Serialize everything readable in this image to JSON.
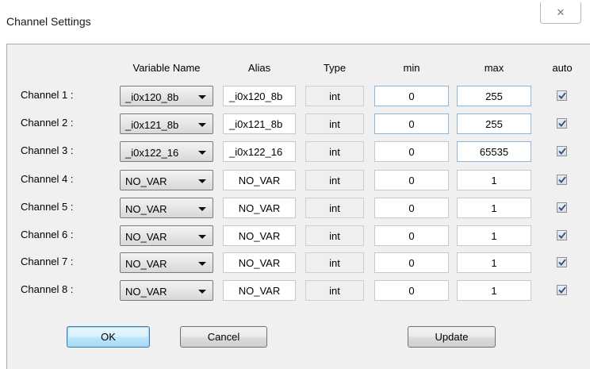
{
  "window": {
    "title": "Channel Settings",
    "close_glyph": "✕"
  },
  "headers": {
    "variable_name": "Variable Name",
    "alias": "Alias",
    "type": "Type",
    "min": "min",
    "max": "max",
    "auto": "auto"
  },
  "channels": [
    {
      "label": "Channel 1 :",
      "variable": "_i0x120_8b",
      "alias": "_i0x120_8b",
      "type": "int",
      "min": "0",
      "max": "255",
      "auto": true
    },
    {
      "label": "Channel 2 :",
      "variable": "_i0x121_8b",
      "alias": "_i0x121_8b",
      "type": "int",
      "min": "0",
      "max": "255",
      "auto": true
    },
    {
      "label": "Channel 3 :",
      "variable": "_i0x122_16",
      "alias": "_i0x122_16",
      "type": "int",
      "min": "0",
      "max": "65535",
      "auto": true
    },
    {
      "label": "Channel 4 :",
      "variable": "NO_VAR",
      "alias": "NO_VAR",
      "type": "int",
      "min": "0",
      "max": "1",
      "auto": true
    },
    {
      "label": "Channel 5 :",
      "variable": "NO_VAR",
      "alias": "NO_VAR",
      "type": "int",
      "min": "0",
      "max": "1",
      "auto": true
    },
    {
      "label": "Channel 6 :",
      "variable": "NO_VAR",
      "alias": "NO_VAR",
      "type": "int",
      "min": "0",
      "max": "1",
      "auto": true
    },
    {
      "label": "Channel 7 :",
      "variable": "NO_VAR",
      "alias": "NO_VAR",
      "type": "int",
      "min": "0",
      "max": "1",
      "auto": true
    },
    {
      "label": "Channel 8 :",
      "variable": "NO_VAR",
      "alias": "NO_VAR",
      "type": "int",
      "min": "0",
      "max": "1",
      "auto": true
    }
  ],
  "buttons": {
    "ok": "OK",
    "cancel": "Cancel",
    "update": "Update"
  },
  "colors": {
    "ok_button_accent": "#3c7fb1",
    "checkmark": "#2c4a7c"
  }
}
